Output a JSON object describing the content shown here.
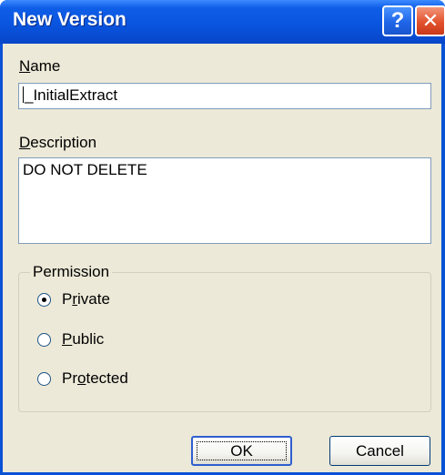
{
  "window": {
    "title": "New Version",
    "help_glyph": "?",
    "close_glyph": "✕"
  },
  "name": {
    "label_first": "N",
    "label_rest": "ame",
    "value": "_InitialExtract"
  },
  "description": {
    "label_first": "D",
    "label_rest": "escription",
    "value": "DO NOT DELETE"
  },
  "permission": {
    "legend": "Permission",
    "options": [
      {
        "pre": "P",
        "u": "r",
        "post": "ivate",
        "selected": true
      },
      {
        "pre": "",
        "u": "P",
        "post": "ublic",
        "selected": false
      },
      {
        "pre": "Pr",
        "u": "o",
        "post": "tected",
        "selected": false
      }
    ]
  },
  "buttons": {
    "ok": "OK",
    "cancel": "Cancel"
  }
}
